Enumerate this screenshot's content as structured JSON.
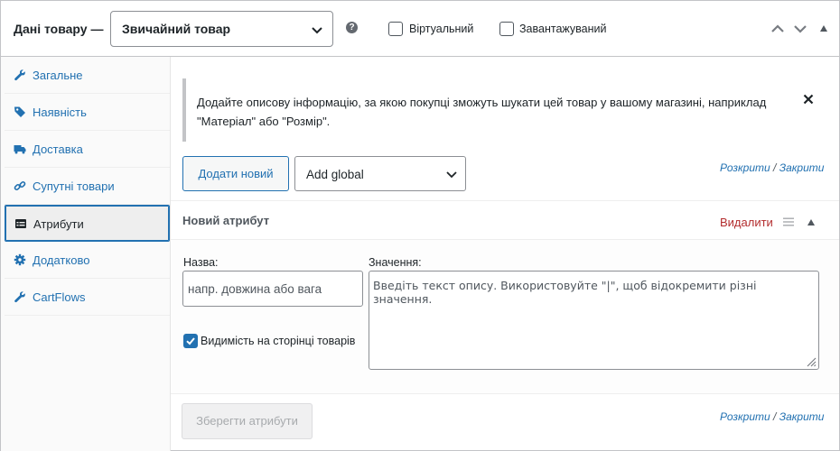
{
  "header": {
    "title": "Дані товару —",
    "product_type": "Звичайний товар",
    "help_icon": "question-circle-icon",
    "virtual_label": "Віртуальний",
    "virtual_checked": false,
    "downloadable_label": "Завантажуваний",
    "downloadable_checked": false,
    "icons": [
      "chevron-up-icon",
      "chevron-down-icon",
      "toggle-arrow-up-icon"
    ]
  },
  "sidebar": {
    "items": [
      {
        "label": "Загальне",
        "icon": "wrench-icon",
        "active": false
      },
      {
        "label": "Наявність",
        "icon": "tag-icon",
        "active": false
      },
      {
        "label": "Доставка",
        "icon": "truck-icon",
        "active": false
      },
      {
        "label": "Супутні товари",
        "icon": "link-icon",
        "active": false
      },
      {
        "label": "Атрибути",
        "icon": "list-table-icon",
        "active": true
      },
      {
        "label": "Додатково",
        "icon": "gear-icon",
        "active": false
      },
      {
        "label": "CartFlows",
        "icon": "wrench-icon",
        "active": false
      }
    ]
  },
  "notice": {
    "text": "Додайте описову інформацію, за якою покупці зможуть шукати цей товар у вашому магазині, наприклад \"Матеріал\" або \"Розмір\".",
    "close_icon": "close-icon"
  },
  "toolbar": {
    "add_new_label": "Додати новий",
    "global_select_value": "Add global",
    "expand_label": "Розкрити",
    "separator": "/",
    "collapse_label": "Закрити"
  },
  "attribute": {
    "title": "Новий атрибут",
    "remove_label": "Видалити",
    "name_label": "Назва:",
    "name_placeholder": "напр. довжина або вага",
    "values_label": "Значення:",
    "values_placeholder": "Введіть текст опису. Використовуйте \"|\", щоб відокремити різні значення.",
    "visible_label": "Видимість на сторінці товарів",
    "visible_checked": true
  },
  "footer": {
    "save_label": "Зберегти атрибути",
    "expand_label": "Розкрити",
    "separator": "/",
    "collapse_label": "Закрити"
  },
  "colors": {
    "accent": "#2271b1",
    "danger": "#b32d2e",
    "border": "#c3c4c7",
    "text": "#1d2327"
  }
}
